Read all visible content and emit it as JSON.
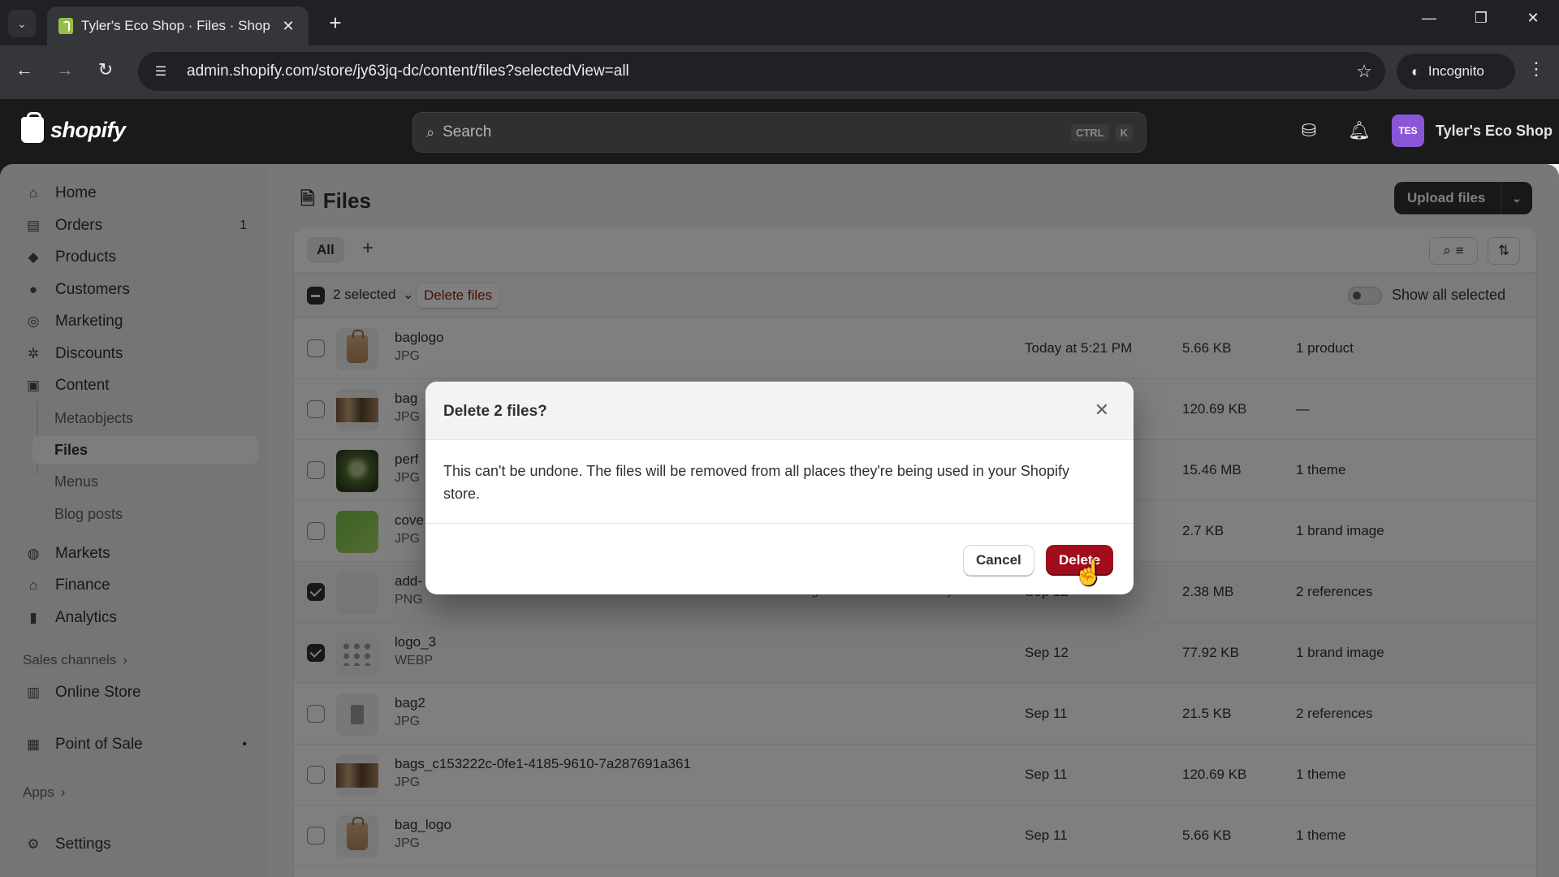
{
  "browser": {
    "tab_title": "Tyler's Eco Shop · Files · Shopify",
    "url": "admin.shopify.com/store/jy63jq-dc/content/files?selectedView=all",
    "incognito_label": "Incognito"
  },
  "topbar": {
    "logo_text": "shopify",
    "search_placeholder": "Search",
    "shortcut_keys": [
      "CTRL",
      "K"
    ],
    "store_initials": "TES",
    "store_name": "Tyler's Eco Shop"
  },
  "sidebar": {
    "items": [
      {
        "label": "Home",
        "icon": "home-icon"
      },
      {
        "label": "Orders",
        "icon": "orders-icon",
        "badge": "1"
      },
      {
        "label": "Products",
        "icon": "tag-icon"
      },
      {
        "label": "Customers",
        "icon": "person-icon"
      },
      {
        "label": "Marketing",
        "icon": "target-icon"
      },
      {
        "label": "Discounts",
        "icon": "discount-icon"
      },
      {
        "label": "Content",
        "icon": "content-icon"
      }
    ],
    "content_sub": [
      {
        "label": "Metaobjects"
      },
      {
        "label": "Files",
        "active": true
      },
      {
        "label": "Menus"
      },
      {
        "label": "Blog posts"
      }
    ],
    "items2": [
      {
        "label": "Markets",
        "icon": "globe-icon"
      },
      {
        "label": "Finance",
        "icon": "bank-icon"
      },
      {
        "label": "Analytics",
        "icon": "chart-icon"
      }
    ],
    "sales_channels_label": "Sales channels",
    "channels": [
      {
        "label": "Online Store",
        "icon": "store-icon"
      },
      {
        "label": "Point of Sale",
        "icon": "pos-icon"
      }
    ],
    "apps_label": "Apps",
    "settings_label": "Settings"
  },
  "page": {
    "title": "Files",
    "upload_label": "Upload files",
    "view_tab": "All",
    "bulk_selected": "2 selected",
    "bulk_delete": "Delete files",
    "show_all_selected": "Show all selected"
  },
  "files": [
    {
      "name": "baglogo",
      "type": "JPG",
      "alt": "",
      "date": "Today at 5:21 PM",
      "size": "5.66 KB",
      "refs": "1 product",
      "selected": false,
      "thumb": "bag"
    },
    {
      "name": "bag",
      "type": "JPG",
      "alt": "",
      "date": "",
      "size": "120.69 KB",
      "refs": "—",
      "selected": false,
      "thumb": "wide"
    },
    {
      "name": "perf",
      "type": "JPG",
      "alt": "",
      "date": "",
      "size": "15.46 MB",
      "refs": "1 theme",
      "selected": false,
      "thumb": "green"
    },
    {
      "name": "cove",
      "type": "JPG",
      "alt": "",
      "date": "",
      "size": "2.7 KB",
      "refs": "1 brand image",
      "selected": false,
      "thumb": "lime"
    },
    {
      "name": "add-",
      "type": "PNG",
      "alt": "add a logo related to eco friendly",
      "date": "Sep 12",
      "size": "2.38 MB",
      "refs": "2 references",
      "selected": true,
      "thumb": "grey"
    },
    {
      "name": "logo_3",
      "type": "WEBP",
      "alt": "",
      "date": "Sep 12",
      "size": "77.92 KB",
      "refs": "1 brand image",
      "selected": true,
      "thumb": "dots"
    },
    {
      "name": "bag2",
      "type": "JPG",
      "alt": "",
      "date": "Sep 11",
      "size": "21.5 KB",
      "refs": "2 references",
      "selected": false,
      "thumb": "small"
    },
    {
      "name": "bags_c153222c-0fe1-4185-9610-7a287691a361",
      "type": "JPG",
      "alt": "",
      "date": "Sep 11",
      "size": "120.69 KB",
      "refs": "1 theme",
      "selected": false,
      "thumb": "wide"
    },
    {
      "name": "bag_logo",
      "type": "JPG",
      "alt": "",
      "date": "Sep 11",
      "size": "5.66 KB",
      "refs": "1 theme",
      "selected": false,
      "thumb": "bag"
    }
  ],
  "modal": {
    "title": "Delete 2 files?",
    "body": "This can't be undone. The files will be removed from all places they're being used in your Shopify store.",
    "cancel_label": "Cancel",
    "delete_label": "Delete"
  },
  "colors": {
    "danger": "#a10d1d",
    "topbar": "#1a1a1a",
    "surface": "#f1f1f1"
  }
}
